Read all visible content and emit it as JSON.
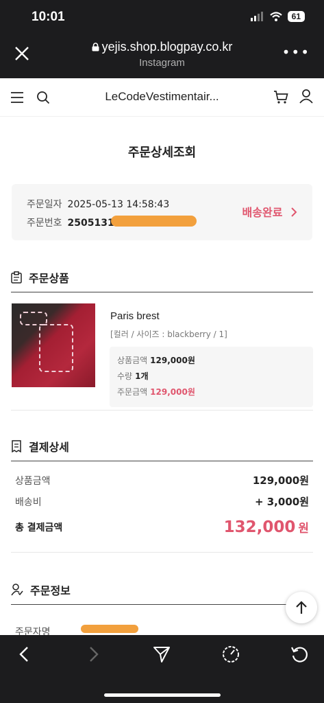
{
  "status_bar": {
    "time": "10:01",
    "battery": "61"
  },
  "browser": {
    "url": "yejis.shop.blogpay.co.kr",
    "source": "Instagram",
    "more": "•••"
  },
  "site": {
    "logo": "LeCodeVestimentair..."
  },
  "page_title": "주문상세조회",
  "order": {
    "date_label": "주문일자",
    "date_value": "2025-05-13 14:58:43",
    "number_label": "주문번호",
    "number_value": "25051314-",
    "status": "배송완료"
  },
  "products_section": {
    "title": "주문상품"
  },
  "product": {
    "name": "Paris brest",
    "option": "[컬러 / 사이즈 : blackberry / 1]",
    "price_label": "상품금액",
    "price": "129,000원",
    "qty_label": "수량",
    "qty": "1개",
    "total_label": "주문금액",
    "total": "129,000원"
  },
  "payment_section": {
    "title": "결제상세"
  },
  "payment": {
    "subtotal_label": "상품금액",
    "subtotal": "129,000원",
    "shipping_label": "배송비",
    "shipping": "+ 3,000원",
    "total_label": "총 결제금액",
    "total": "132,000",
    "total_unit": "원"
  },
  "info_section": {
    "title": "주문정보",
    "orderer_label": "주문자명"
  },
  "colors": {
    "accent": "#e0566e",
    "order_number": "#a8916f",
    "redaction": "#f2a03d"
  }
}
